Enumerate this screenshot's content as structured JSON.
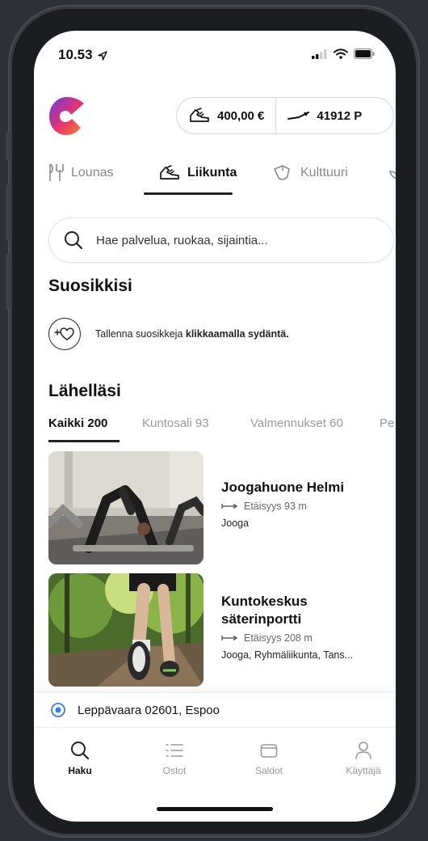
{
  "status": {
    "time": "10.53"
  },
  "balance": {
    "money": "400,00 €",
    "points": "41912 P"
  },
  "categories": [
    {
      "label": "Lounas",
      "icon": "fork-knife-icon"
    },
    {
      "label": "Liikunta",
      "icon": "running-shoe-icon"
    },
    {
      "label": "Kulttuuri",
      "icon": "theater-masks-icon"
    }
  ],
  "search": {
    "placeholder": "Hae palvelua, ruokaa, sijaintia..."
  },
  "favorites": {
    "title": "Suosikkisi",
    "hint_prefix": "Tallenna suosikkeja ",
    "hint_bold": "klikkaamalla sydäntä."
  },
  "nearby": {
    "title": "Lähelläsi",
    "filters": [
      "Kaikki 200",
      "Kuntosali 93",
      "Valmennukset 60",
      "Pe"
    ],
    "items": [
      {
        "name": "Joogahuone Helmi",
        "distance": "Etäisyys 93 m",
        "tags": "Jooga"
      },
      {
        "name_line1": "Kuntokeskus",
        "name_line2": "säterinportti",
        "distance": "Etäisyys 208 m",
        "tags": "Jooga, Ryhmäliikunta, Tans..."
      }
    ]
  },
  "location": {
    "text": "Leppävaara 02601, Espoo"
  },
  "tabs": [
    {
      "label": "Haku",
      "icon": "search-icon"
    },
    {
      "label": "Ostot",
      "icon": "list-icon"
    },
    {
      "label": "Saldot",
      "icon": "wallet-icon"
    },
    {
      "label": "Käyttäjä",
      "icon": "user-icon"
    }
  ],
  "colors": {
    "accent_pink": "#e8336d",
    "accent_purple": "#6a3be0",
    "accent_orange": "#f28c28",
    "location_blue": "#2f7ee8"
  }
}
